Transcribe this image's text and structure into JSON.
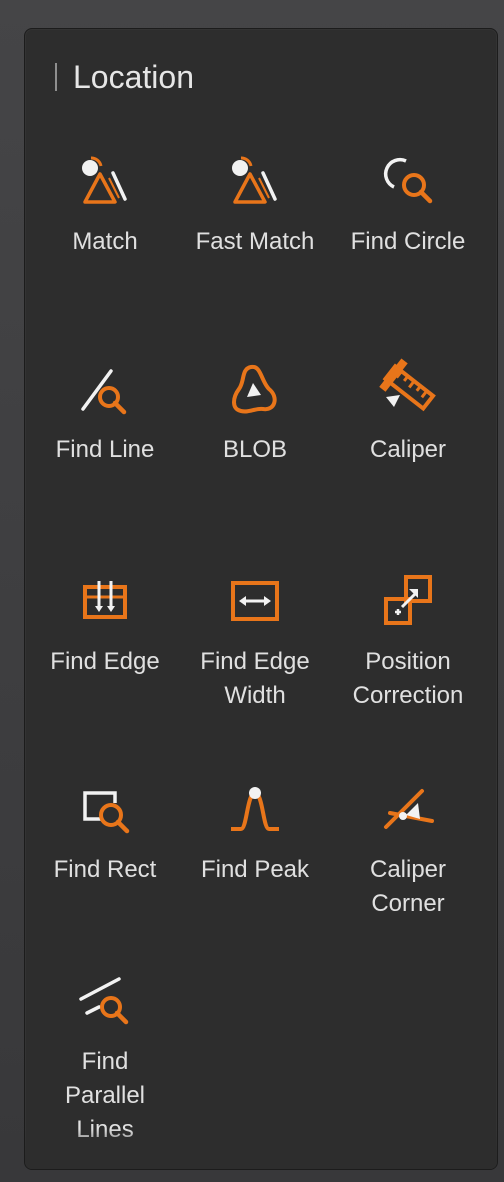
{
  "panel": {
    "section_title": "Location",
    "accent_color": "#e8751a",
    "tools": [
      {
        "label": "Match",
        "icon": "match-icon"
      },
      {
        "label": "Fast Match",
        "icon": "fast-match-icon"
      },
      {
        "label": "Find Circle",
        "icon": "find-circle-icon"
      },
      {
        "label": "Find Line",
        "icon": "find-line-icon"
      },
      {
        "label": "BLOB",
        "icon": "blob-icon"
      },
      {
        "label": "Caliper",
        "icon": "caliper-icon"
      },
      {
        "label": "Find Edge",
        "icon": "find-edge-icon"
      },
      {
        "label": "Find Edge\nWidth",
        "icon": "find-edge-width-icon"
      },
      {
        "label": "Position\nCorrection",
        "icon": "position-correction-icon"
      },
      {
        "label": "Find Rect",
        "icon": "find-rect-icon"
      },
      {
        "label": "Find Peak",
        "icon": "find-peak-icon"
      },
      {
        "label": "Caliper\nCorner",
        "icon": "caliper-corner-icon"
      },
      {
        "label": "Find\nParallel\nLines",
        "icon": "find-parallel-lines-icon"
      }
    ]
  }
}
